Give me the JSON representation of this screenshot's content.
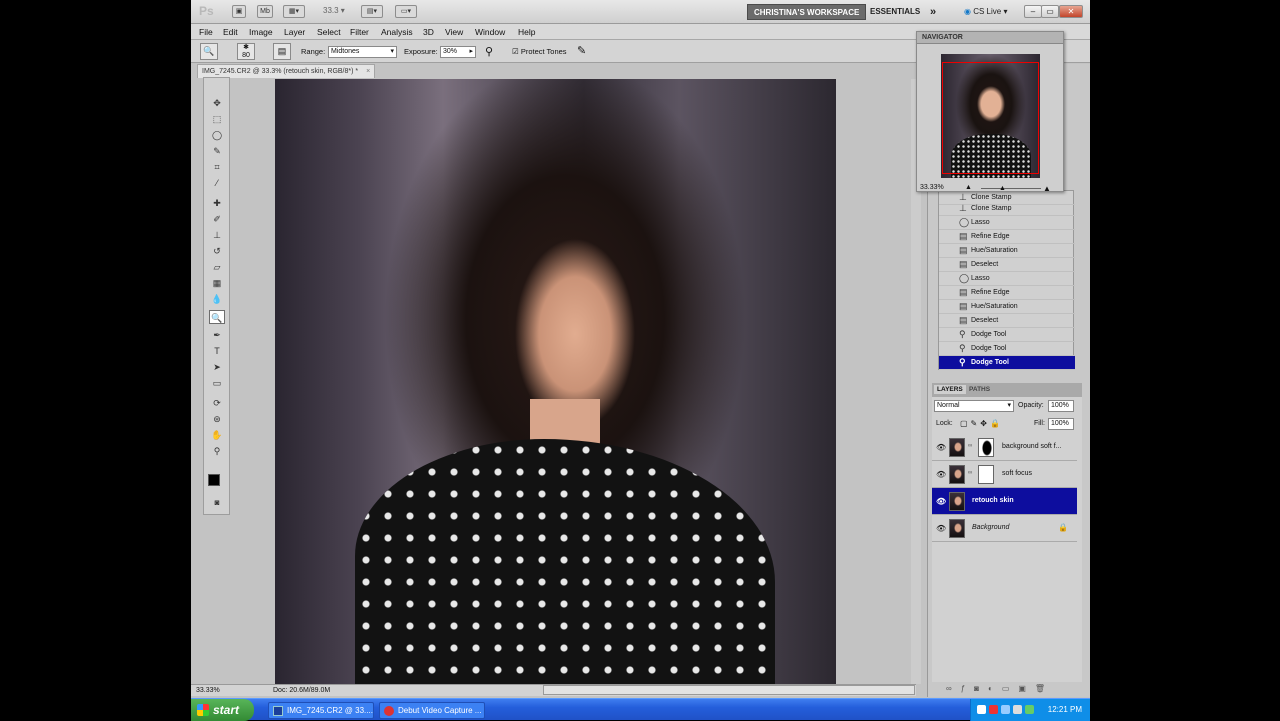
{
  "app": {
    "logo": "Ps",
    "zoom_display": "33.3",
    "workspace_active": "CHRISTINA'S WORKSPACE",
    "workspace_essentials": "ESSENTIALS",
    "workspace_more": "»",
    "cs_live": "CS Live"
  },
  "menu": [
    "File",
    "Edit",
    "Image",
    "Layer",
    "Select",
    "Filter",
    "Analysis",
    "3D",
    "View",
    "Window",
    "Help"
  ],
  "options": {
    "range_label": "Range:",
    "range_value": "Midtones",
    "exposure_label": "Exposure:",
    "exposure_value": "30%",
    "protect_tones": "Protect Tones",
    "brush_size": "80"
  },
  "document": {
    "tab_title": "IMG_7245.CR2 @ 33.3% (retouch skin, RGB/8*) *",
    "tab_close": "×",
    "status_zoom": "33.33%",
    "status_doc": "Doc: 20.6M/89.0M"
  },
  "navigator": {
    "title": "NAVIGATOR",
    "zoom": "33.33%"
  },
  "history": [
    {
      "label": "Clone Stamp",
      "icon": "stamp"
    },
    {
      "label": "Clone Stamp",
      "icon": "stamp"
    },
    {
      "label": "Lasso",
      "icon": "lasso"
    },
    {
      "label": "Refine Edge",
      "icon": "step"
    },
    {
      "label": "Hue/Saturation",
      "icon": "step"
    },
    {
      "label": "Deselect",
      "icon": "step"
    },
    {
      "label": "Lasso",
      "icon": "lasso"
    },
    {
      "label": "Refine Edge",
      "icon": "step"
    },
    {
      "label": "Hue/Saturation",
      "icon": "step"
    },
    {
      "label": "Deselect",
      "icon": "step"
    },
    {
      "label": "Dodge Tool",
      "icon": "dodge"
    },
    {
      "label": "Dodge Tool",
      "icon": "dodge"
    },
    {
      "label": "Dodge Tool",
      "icon": "dodge",
      "selected": true
    }
  ],
  "layers_panel": {
    "tab_layers": "LAYERS",
    "tab_paths": "PATHS",
    "blend_mode": "Normal",
    "opacity_label": "Opacity:",
    "opacity_value": "100%",
    "lock_label": "Lock:",
    "fill_label": "Fill:",
    "fill_value": "100%",
    "layers": [
      {
        "name": "background soft f...",
        "mask": "dark"
      },
      {
        "name": "soft focus",
        "mask": "white"
      },
      {
        "name": "retouch skin",
        "selected": true
      },
      {
        "name": "Background",
        "locked": true
      }
    ]
  },
  "taskbar": {
    "start": "start",
    "items": [
      "IMG_7245.CR2 @ 33....",
      "Debut Video Capture ..."
    ],
    "clock": "12:21 PM"
  }
}
